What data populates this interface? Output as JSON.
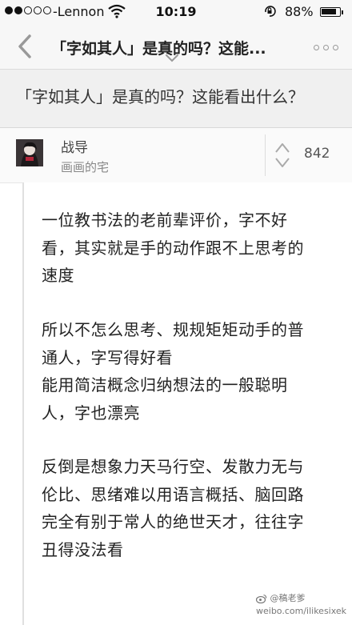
{
  "status_bar": {
    "carrier": "-Lennon",
    "time": "10:19",
    "battery": "88%",
    "battery_level": 0.88
  },
  "nav": {
    "title": "「字如其人」是真的吗？这能..."
  },
  "question": {
    "title": "「字如其人」是真的吗？这能看出什么？"
  },
  "author": {
    "name": "战导",
    "bio": "画画的宅",
    "votes": "842"
  },
  "answer": {
    "paragraphs": [
      "一位教书法的老前辈评价，字不好看，其实就是手的动作跟不上思考的速度",
      "所以不怎么思考、规规矩矩动手的普通人，字写得好看\n能用简洁概念归纳想法的一般聪明人，字也漂亮",
      "反倒是想象力天马行空、发散力无与伦比、思绪难以用语言概括、脑回路完全有别于常人的绝世天才，往往字丑得没法看"
    ]
  },
  "watermark": {
    "line1": "@稿老爹",
    "line2": "weibo.com/ilikesixek"
  },
  "icons": {
    "back": "chevron-left-icon",
    "more": "more-dots-icon",
    "vote": "vote-arrows-icon",
    "wifi": "wifi-icon",
    "lock": "rotation-lock-icon"
  }
}
